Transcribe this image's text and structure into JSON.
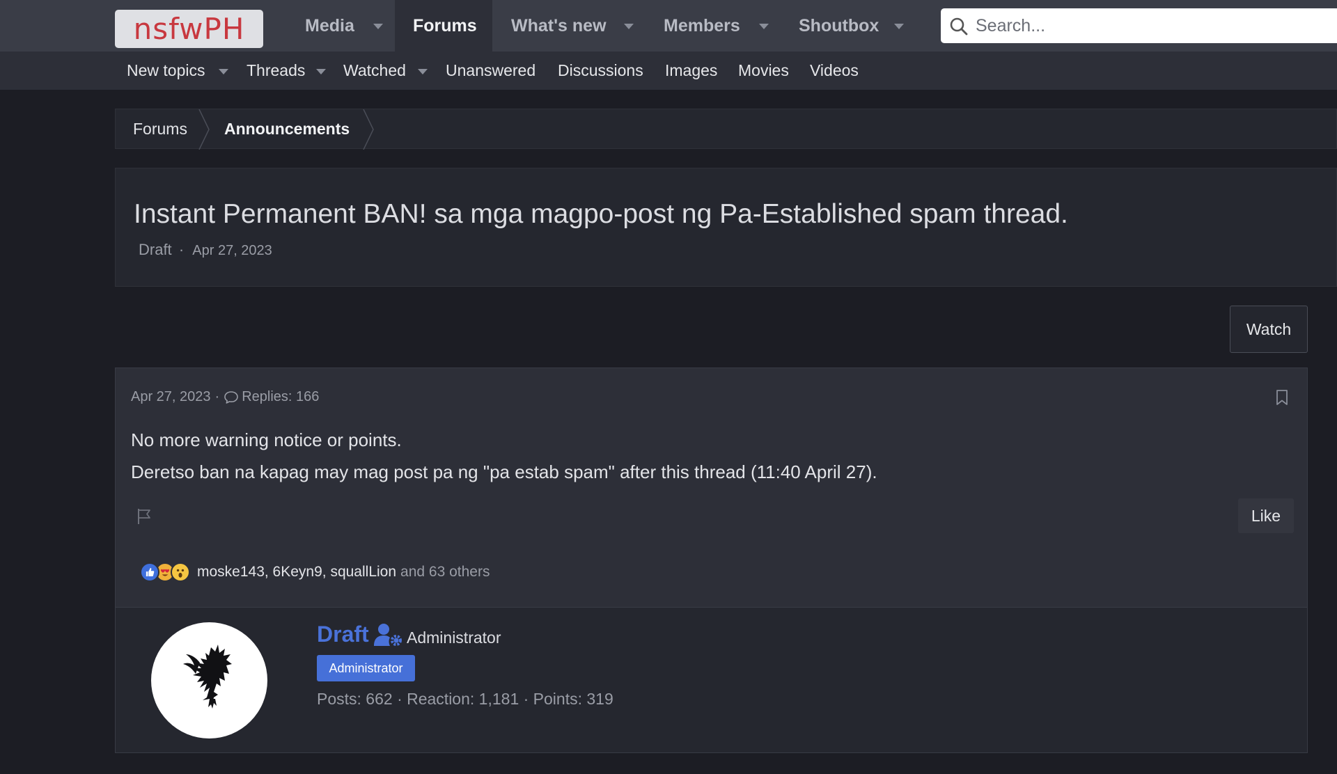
{
  "brand": {
    "logo_text": "nsfwPH",
    "logo_color": "#c8383f"
  },
  "nav": {
    "tabs": [
      {
        "label": "Media",
        "active": false,
        "has_dropdown": true
      },
      {
        "label": "Forums",
        "active": true,
        "has_dropdown": false
      },
      {
        "label": "What's new",
        "active": false,
        "has_dropdown": true
      },
      {
        "label": "Members",
        "active": false,
        "has_dropdown": true
      },
      {
        "label": "Shoutbox",
        "active": false,
        "has_dropdown": true
      }
    ],
    "search": {
      "placeholder": "Search...",
      "value": "",
      "icon": "search-icon"
    }
  },
  "subnav": {
    "items": [
      {
        "label": "New topics",
        "has_dropdown": true
      },
      {
        "label": "Threads",
        "has_dropdown": true
      },
      {
        "label": "Watched",
        "has_dropdown": true
      },
      {
        "label": "Unanswered",
        "has_dropdown": false
      },
      {
        "label": "Discussions",
        "has_dropdown": false
      },
      {
        "label": "Images",
        "has_dropdown": false
      },
      {
        "label": "Movies",
        "has_dropdown": false
      },
      {
        "label": "Videos",
        "has_dropdown": false
      }
    ]
  },
  "breadcrumb": [
    "Forums",
    "Announcements"
  ],
  "thread": {
    "title": "Instant Permanent BAN! sa mga magpo-post ng Pa-Established spam thread.",
    "author": "Draft",
    "separator": "·",
    "date": "Apr 27, 2023"
  },
  "actions": {
    "watch_label": "Watch"
  },
  "post": {
    "date": "Apr 27, 2023",
    "separator": "·",
    "replies": "Replies: 166",
    "body": [
      "No more warning notice or points.",
      "Deretso ban na kapag may mag post pa ng \"pa estab spam\" after this thread (11:40 April 27)."
    ],
    "like_label": "Like",
    "reactions": {
      "icons": [
        "like-reaction-icon",
        "love-reaction-icon",
        "wow-reaction-icon"
      ],
      "users": [
        "moske143",
        "6Keyn9",
        "squallLion"
      ],
      "users_text": "moske143, 6Keyn9, squallLion",
      "more": "and 63 others"
    }
  },
  "author": {
    "name": "Draft",
    "name_color": "#4a72d9",
    "title": "Administrator",
    "badge": "Administrator",
    "badge_color": "#4670d8",
    "stats": "Posts: 662 · Reaction: 1,181 · Points: 319"
  },
  "colors": {
    "accent": "#4a72d9",
    "background": "#1c1d24",
    "topbar": "#3a3d47"
  }
}
